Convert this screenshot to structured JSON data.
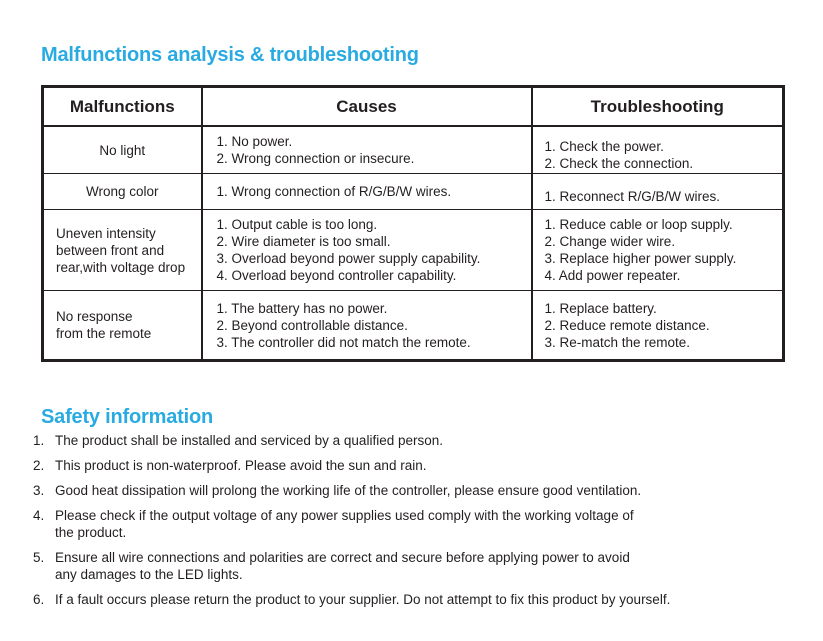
{
  "document": {
    "accent_color": "#29abe2",
    "text_color": "#231f20",
    "border_color": "#231f20"
  },
  "malfunctions_section": {
    "heading": "Malfunctions analysis & troubleshooting",
    "table": {
      "headers": [
        "Malfunctions",
        "Causes",
        "Troubleshooting"
      ],
      "rows": [
        {
          "malfunction": [
            "No light"
          ],
          "causes": [
            "1. No power.",
            "2. Wrong connection or insecure."
          ],
          "troubleshooting": [
            "1. Check the power.",
            "2. Check the connection."
          ]
        },
        {
          "malfunction": [
            "Wrong color"
          ],
          "causes": [
            "1. Wrong connection of R/G/B/W wires."
          ],
          "troubleshooting": [
            "1. Reconnect R/G/B/W wires."
          ]
        },
        {
          "malfunction": [
            "Uneven intensity",
            "between front and",
            "rear,with voltage drop"
          ],
          "causes": [
            "1. Output cable is too long.",
            "2. Wire diameter is too small.",
            "3. Overload beyond power supply capability.",
            "4. Overload beyond controller capability."
          ],
          "troubleshooting": [
            "1. Reduce cable or loop supply.",
            "2. Change wider wire.",
            "3. Replace higher power supply.",
            "4. Add power repeater."
          ]
        },
        {
          "malfunction": [
            "No response",
            "from the remote"
          ],
          "causes": [
            "1. The battery has no power.",
            "2. Beyond controllable distance.",
            "3. The controller did not match the remote."
          ],
          "troubleshooting": [
            "1. Replace battery.",
            "2. Reduce remote distance.",
            "3. Re-match the remote."
          ]
        }
      ]
    }
  },
  "safety_section": {
    "heading": "Safety information",
    "items": [
      {
        "number": "1.",
        "lines": [
          "The product shall be installed and serviced by a qualified person."
        ]
      },
      {
        "number": "2.",
        "lines": [
          "This product is non-waterproof. Please avoid the sun and rain."
        ]
      },
      {
        "number": "3.",
        "lines": [
          "Good heat dissipation will prolong the working life of the controller, please ensure good ventilation."
        ]
      },
      {
        "number": "4.",
        "lines": [
          "Please check if the output voltage of any power supplies used comply with the working voltage of",
          "the product."
        ]
      },
      {
        "number": "5.",
        "lines": [
          "Ensure all wire connections and polarities are correct and secure before applying power to avoid",
          "any damages to the LED lights."
        ]
      },
      {
        "number": "6.",
        "lines": [
          "If a fault occurs please return the product to your supplier. Do not attempt to fix this product by yourself."
        ]
      }
    ]
  }
}
